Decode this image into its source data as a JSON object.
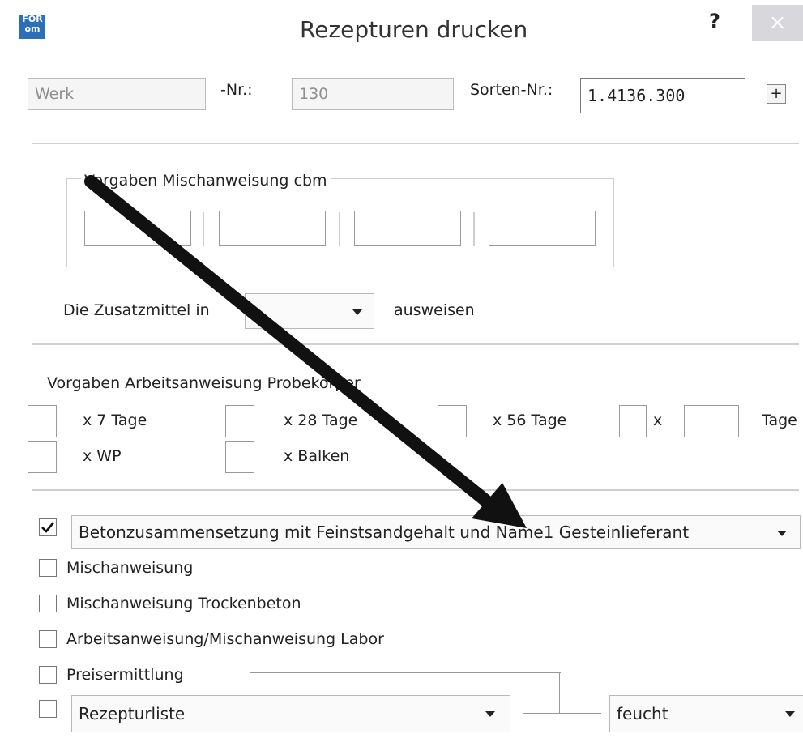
{
  "window": {
    "title": "Rezepturen drucken",
    "icon_name": "app-icon",
    "icon_text_top": "FOR",
    "icon_text_bottom": "om",
    "help_label": "?",
    "close_label": "×"
  },
  "header": {
    "werk_placeholder": "Werk",
    "nr_label": "-Nr.:",
    "nr_value": "130",
    "sorten_label": "Sorten-Nr.:",
    "sorten_value": "1.4136.300",
    "plus_label": "+"
  },
  "mischanweisung": {
    "group_label": "Vorgaben Mischanweisung cbm",
    "fields": [
      "",
      "",
      "",
      ""
    ]
  },
  "zusatzmittel": {
    "label_before": "Die Zusatzmittel in",
    "selected": "",
    "label_after": "ausweisen"
  },
  "arbeitsanweisung": {
    "group_label": "Vorgaben Arbeitsanweisung Probekörper",
    "items": {
      "tage7": "x 7 Tage",
      "tage28": "x 28 Tage",
      "tage56": "x 56 Tage",
      "x": "x",
      "tage": "Tage",
      "wp": "x WP",
      "balken": "x Balken"
    }
  },
  "print_options": {
    "main_combo_selected": "Betonzusammensetzung mit Feinstsandgehalt und Name1 Gesteinlieferant",
    "main_checked": true,
    "items": [
      {
        "label": "Mischanweisung",
        "checked": false
      },
      {
        "label": "Mischanweisung Trockenbeton",
        "checked": false
      },
      {
        "label": "Arbeitsanweisung/Mischanweisung Labor",
        "checked": false
      },
      {
        "label": "Preisermittlung",
        "checked": false
      }
    ],
    "rezepturliste_selected": "Rezepturliste",
    "feucht_selected": "feucht"
  },
  "annotation": {
    "arrow_color": "#111111"
  }
}
